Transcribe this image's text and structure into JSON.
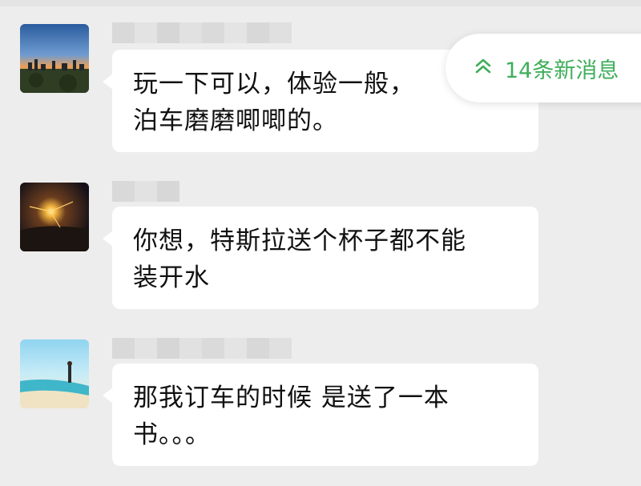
{
  "new_messages_pill": {
    "label": "14条新消息",
    "icon": "double-chevron-up-icon",
    "color": "#3fae5a"
  },
  "messages": [
    {
      "avatar": "city-skyline-avatar",
      "lines": [
        "玩一下可以，体验一般，",
        "泊车磨磨唧唧的。"
      ]
    },
    {
      "avatar": "sunset-avatar",
      "lines": [
        "你想，特斯拉送个杯子都不能",
        "装开水"
      ]
    },
    {
      "avatar": "beach-avatar",
      "lines": [
        "那我订车的时候 是送了一本",
        "书。。。"
      ]
    }
  ],
  "colors": {
    "background": "#ededed",
    "bubble": "#ffffff",
    "text": "#111111",
    "accent": "#3fae5a"
  }
}
